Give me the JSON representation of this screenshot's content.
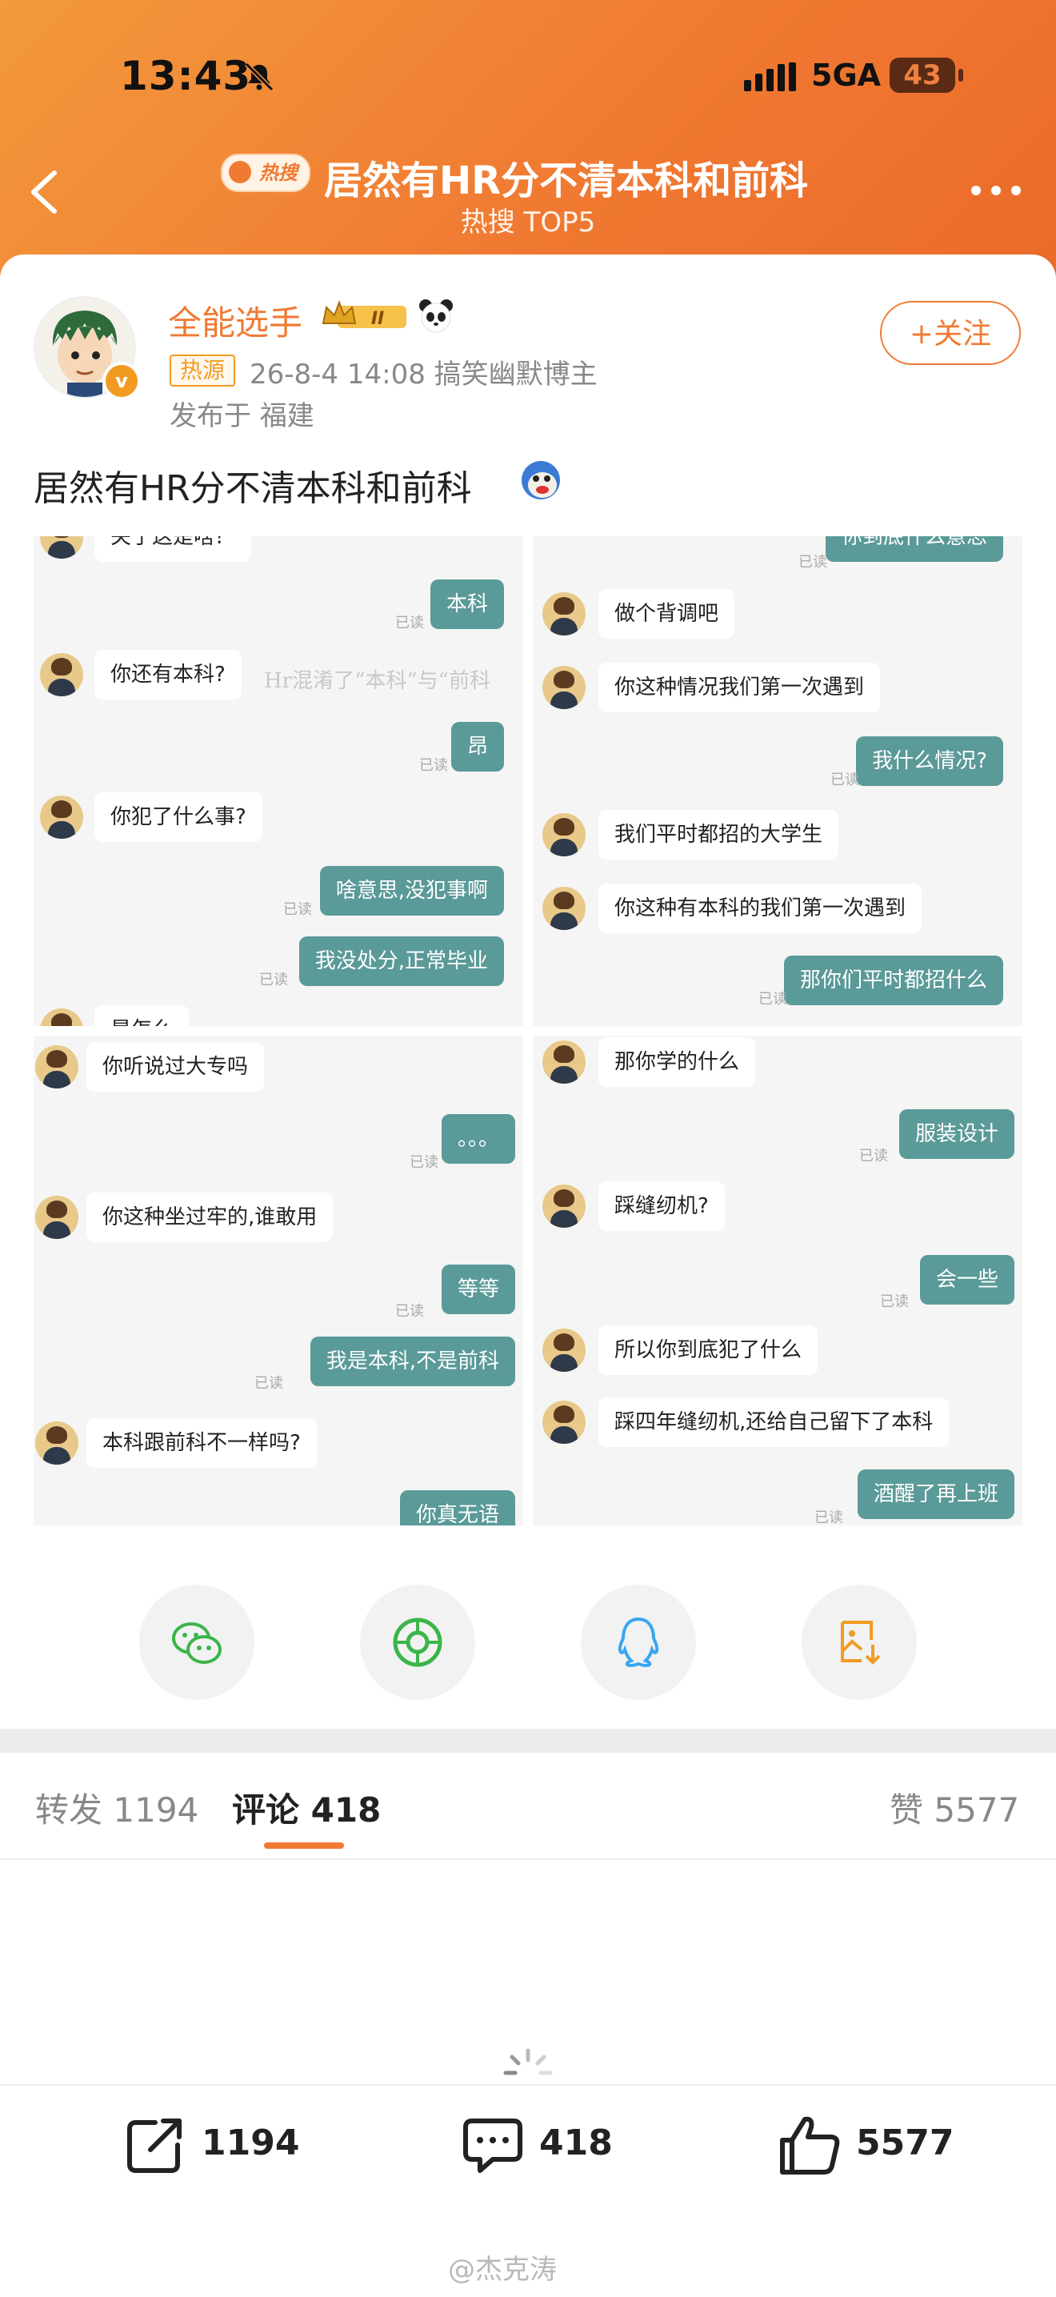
{
  "status_bar": {
    "time": "13:43",
    "network": "5GA",
    "battery": "43"
  },
  "nav": {
    "badge": "热搜",
    "title": "居然有HR分不清本科和前科",
    "subtitle": "热搜 TOP5"
  },
  "post": {
    "username": "全能选手",
    "level": "II",
    "tag": "热源",
    "meta": "26-8-4 14:08  搞笑幽默博主",
    "location": "发布于 福建",
    "follow_label": "+关注",
    "text": "居然有HR分不清本科和前科"
  },
  "chat_panels": {
    "p1": {
      "top_clip": "关于这是啥？",
      "m1": "本科",
      "m2": "你还有本科?",
      "m3": "昂",
      "m4": "你犯了什么事?",
      "m5": "啥意思,没犯事啊",
      "m6": "我没处分,正常毕业",
      "bottom_clip": "是怎么",
      "watermark": "Hr混淆了“本科”与“前科"
    },
    "p2": {
      "top_clip": "你到底什么意思",
      "m1": "做个背调吧",
      "m2": "你这种情况我们第一次遇到",
      "m3": "我什么情况?",
      "m4": "我们平时都招的大学生",
      "m5": "你这种有本科的我们第一次遇到",
      "m6": "那你们平时都招什么"
    },
    "p3": {
      "m1": "你听说过大专吗",
      "m2": "。。。",
      "m3": "你这种坐过牢的,谁敢用",
      "m4": "等等",
      "m5": "我是本科,不是前科",
      "m6": "本科跟前科不一样吗?",
      "m7": "你真无语"
    },
    "p4": {
      "m1": "那你学的什么",
      "m2": "服装设计",
      "m3": "踩缝纫机?",
      "m4": "会一些",
      "m5": "所以你到底犯了什么",
      "m6": "踩四年缝纫机,还给自己留下了本科",
      "m7": "酒醒了再上班"
    },
    "read_label": "已读"
  },
  "share": [
    "wechat-icon",
    "moments-icon",
    "qq-icon",
    "save-image-icon"
  ],
  "tabs": {
    "repost_label": "转发",
    "repost_count": "1194",
    "comment_label": "评论",
    "comment_count": "418",
    "like_label": "赞",
    "like_count": "5577"
  },
  "bottom_bar": {
    "repost": "1194",
    "comment": "418",
    "like": "5577"
  },
  "watermark": "@杰克涛",
  "colors": {
    "accent": "#f07a32",
    "bubble_right": "#5a9a98",
    "header_gradient_start": "#f39a3c"
  }
}
